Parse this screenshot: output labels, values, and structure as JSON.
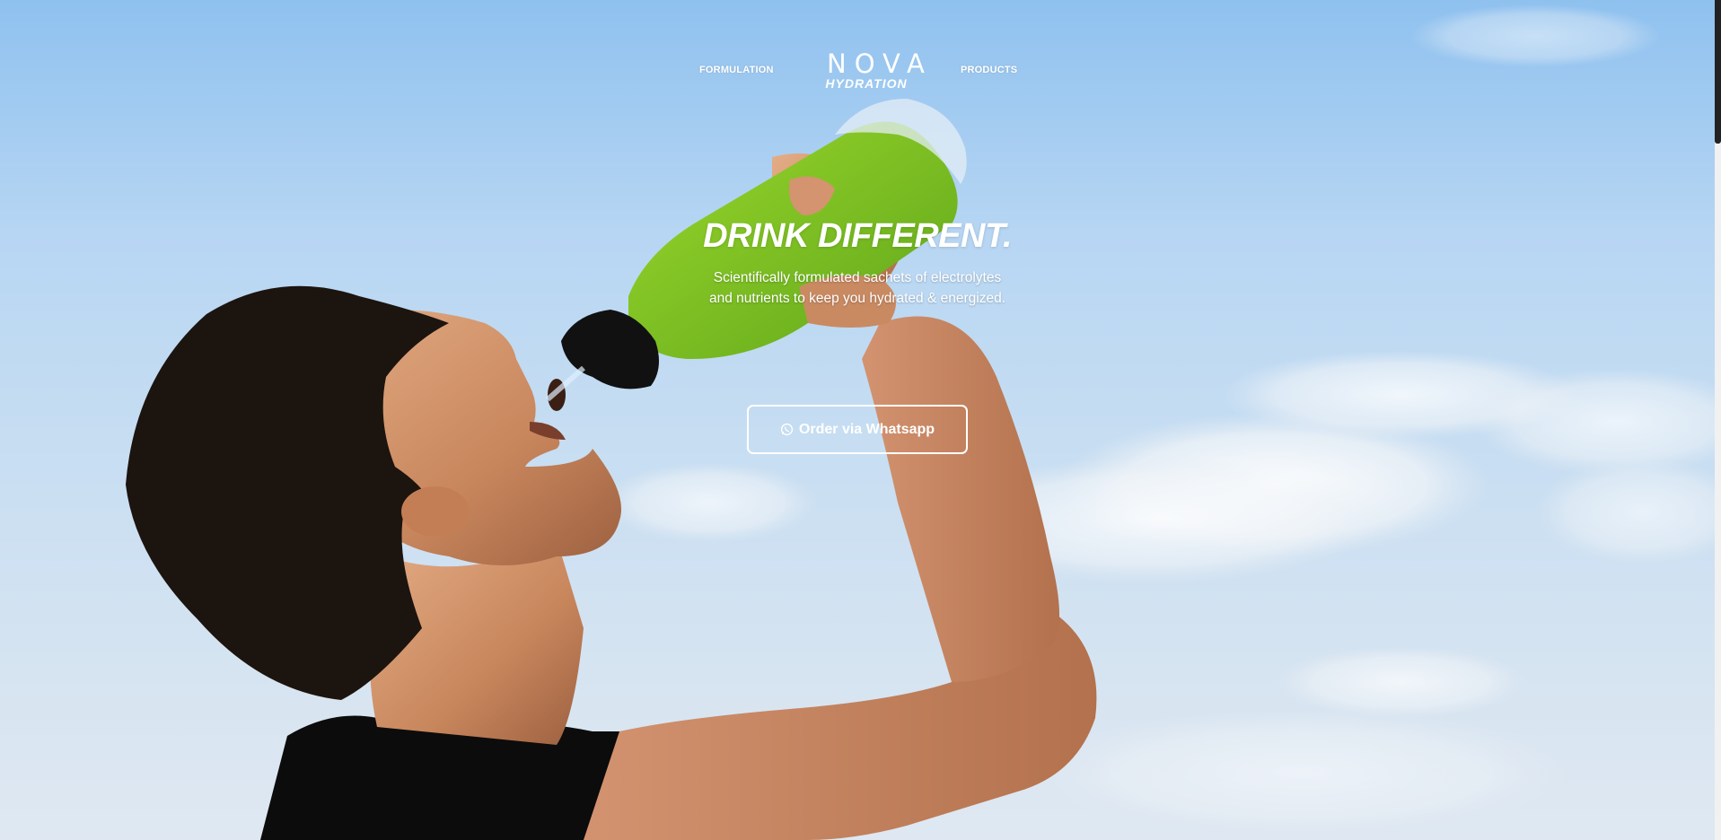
{
  "nav": {
    "formulation": "FORMULATION",
    "products": "PRODUCTS",
    "logo_top": "NOVA",
    "logo_bottom": "HYDRATION"
  },
  "hero": {
    "headline": "DRINK DIFFERENT.",
    "subtext_line1": "Scientifically formulated sachets of electrolytes",
    "subtext_line2": "and nutrients to keep you hydrated & energized.",
    "cta_label": "Order via Whatsapp",
    "cta_icon": "whatsapp-icon"
  },
  "colors": {
    "sky": "#a9cdf0",
    "bottle_liquid": "#7cc421",
    "text": "#ffffff"
  }
}
